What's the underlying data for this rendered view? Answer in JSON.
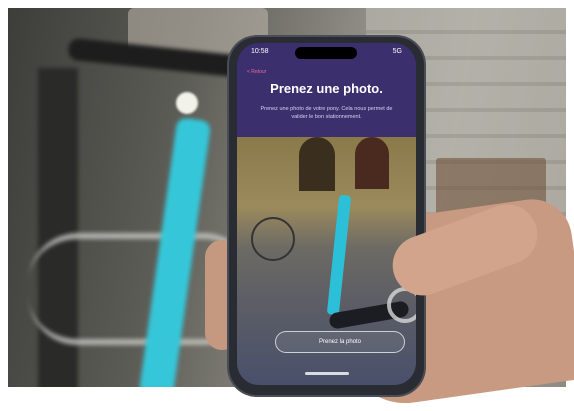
{
  "phone": {
    "status": {
      "time": "10:58",
      "signal": "5G"
    },
    "back_label": "< Retour",
    "title": "Prenez une photo.",
    "description": "Prenez une photo de votre pony. Cela nous permet de valider le bon stationnement.",
    "cta_label": "Prenez la photo"
  },
  "colors": {
    "screen_bg": "#3b2f6e",
    "accent": "#e86a9a",
    "scooter": "#35c7d9"
  }
}
